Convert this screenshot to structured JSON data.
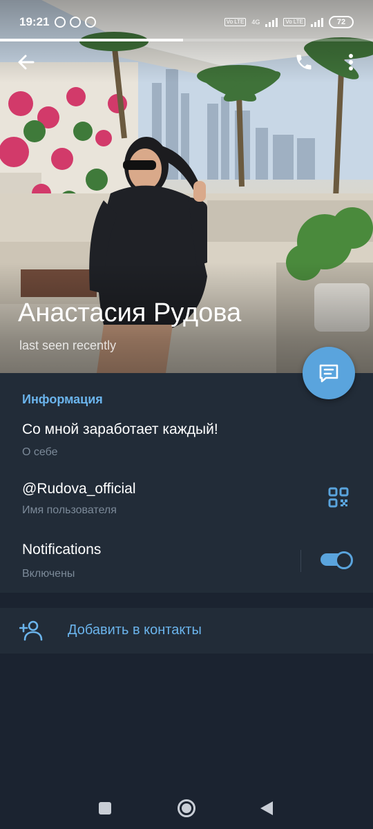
{
  "status_bar": {
    "time": "19:21",
    "network_label": "4G",
    "lte_label": "Vo LTE",
    "battery": "72"
  },
  "story_progress": 0.49,
  "profile": {
    "name": "Анастасия Рудова",
    "status": "last seen recently"
  },
  "info": {
    "section_title": "Информация",
    "bio": "Со мной заработает каждый!",
    "bio_label": "О себе",
    "username": "@Rudova_official",
    "username_label": "Имя пользователя",
    "notifications": "Notifications",
    "notifications_state": "Включены",
    "notifications_on": true
  },
  "add_contact": {
    "label": "Добавить в контакты"
  },
  "icons": {
    "back": "arrow-left-icon",
    "call": "phone-icon",
    "more": "more-vertical-icon",
    "message": "message-icon",
    "qr": "qr-code-icon",
    "add_user": "add-user-icon"
  },
  "colors": {
    "accent": "#5aa4dd",
    "card_bg": "#222c38",
    "page_bg": "#1b2330",
    "section_title": "#6bb4ec",
    "subtext": "#7c8a99"
  }
}
